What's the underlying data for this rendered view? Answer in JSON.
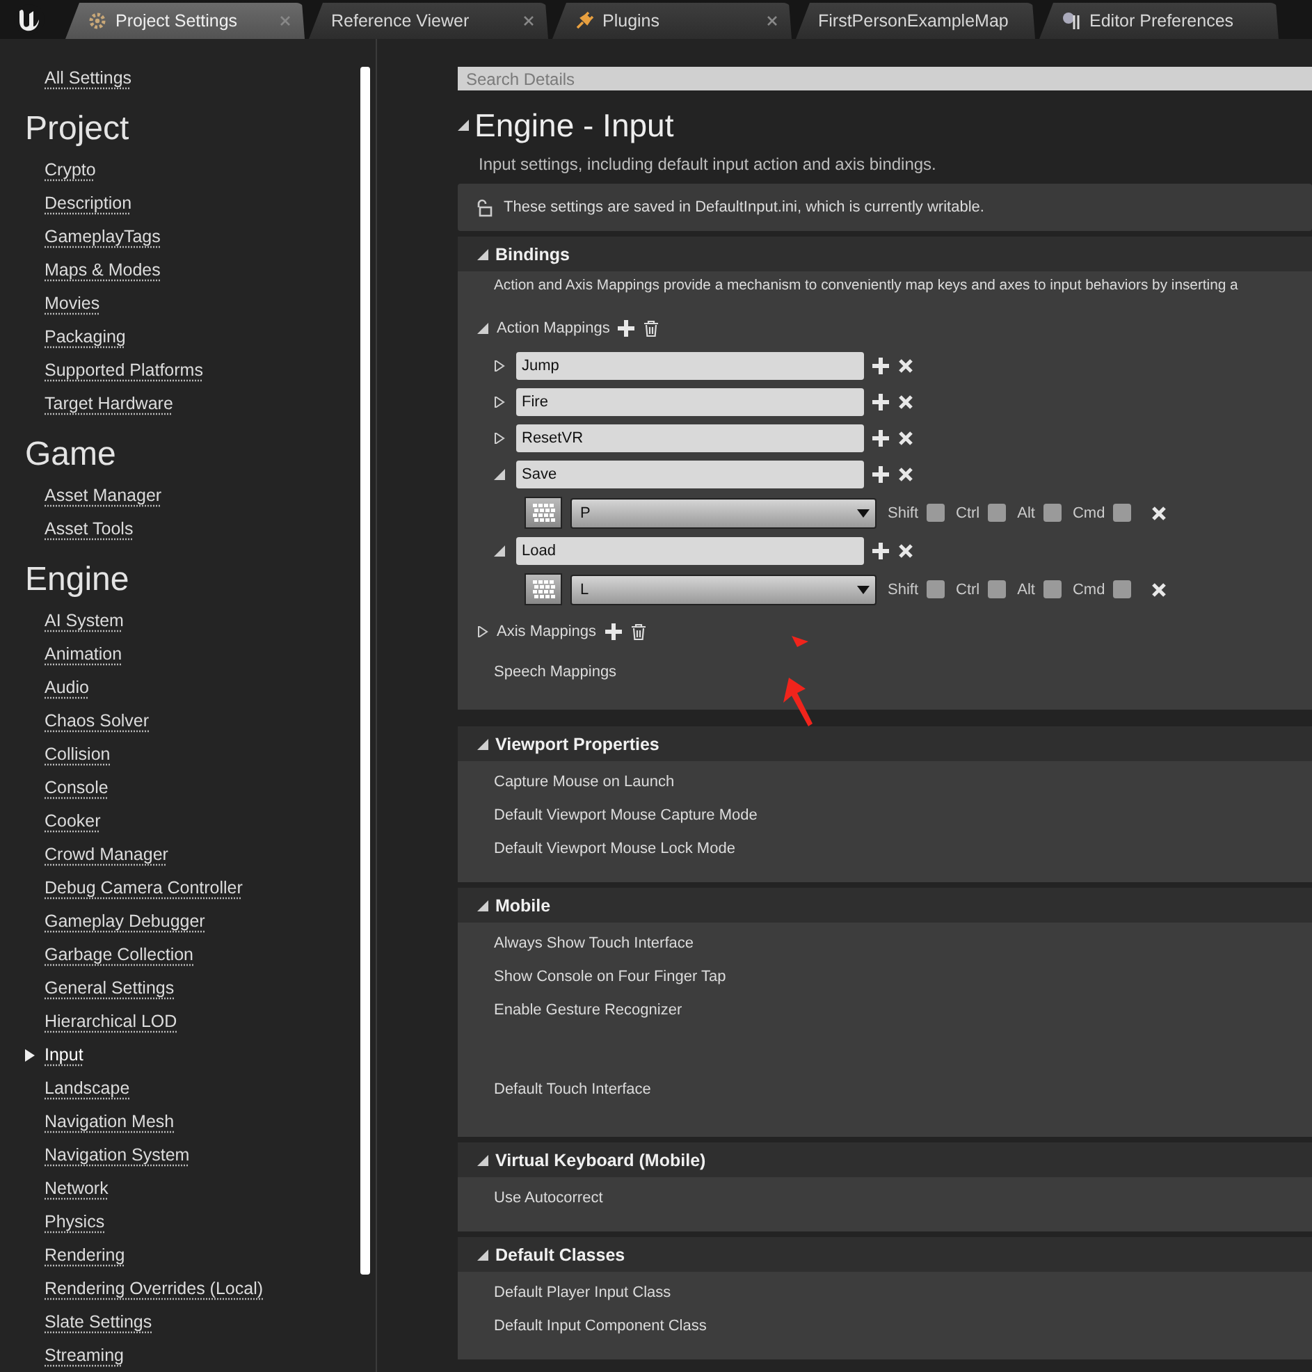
{
  "tabs": [
    {
      "label": "Project Settings",
      "selected": true,
      "closable": true
    },
    {
      "label": "Reference Viewer",
      "selected": false,
      "closable": true
    },
    {
      "label": "Plugins",
      "selected": false,
      "closable": true
    },
    {
      "label": "FirstPersonExampleMap",
      "selected": false,
      "closable": false
    },
    {
      "label": "Editor Preferences",
      "selected": false,
      "closable": false
    }
  ],
  "sidebar": {
    "all_settings": "All Settings",
    "groups": [
      {
        "title": "Project",
        "items": [
          {
            "label": "Crypto",
            "selected": false
          },
          {
            "label": "Description",
            "selected": false
          },
          {
            "label": "GameplayTags",
            "selected": false
          },
          {
            "label": "Maps & Modes",
            "selected": false
          },
          {
            "label": "Movies",
            "selected": false
          },
          {
            "label": "Packaging",
            "selected": false
          },
          {
            "label": "Supported Platforms",
            "selected": false
          },
          {
            "label": "Target Hardware",
            "selected": false
          }
        ]
      },
      {
        "title": "Game",
        "items": [
          {
            "label": "Asset Manager",
            "selected": false
          },
          {
            "label": "Asset Tools",
            "selected": false
          }
        ]
      },
      {
        "title": "Engine",
        "items": [
          {
            "label": "AI System",
            "selected": false
          },
          {
            "label": "Animation",
            "selected": false
          },
          {
            "label": "Audio",
            "selected": false
          },
          {
            "label": "Chaos Solver",
            "selected": false
          },
          {
            "label": "Collision",
            "selected": false
          },
          {
            "label": "Console",
            "selected": false
          },
          {
            "label": "Cooker",
            "selected": false
          },
          {
            "label": "Crowd Manager",
            "selected": false
          },
          {
            "label": "Debug Camera Controller",
            "selected": false
          },
          {
            "label": "Gameplay Debugger",
            "selected": false
          },
          {
            "label": "Garbage Collection",
            "selected": false
          },
          {
            "label": "General Settings",
            "selected": false
          },
          {
            "label": "Hierarchical LOD",
            "selected": false
          },
          {
            "label": "Input",
            "selected": true
          },
          {
            "label": "Landscape",
            "selected": false
          },
          {
            "label": "Navigation Mesh",
            "selected": false
          },
          {
            "label": "Navigation System",
            "selected": false
          },
          {
            "label": "Network",
            "selected": false
          },
          {
            "label": "Physics",
            "selected": false
          },
          {
            "label": "Rendering",
            "selected": false
          },
          {
            "label": "Rendering Overrides (Local)",
            "selected": false
          },
          {
            "label": "Slate Settings",
            "selected": false
          },
          {
            "label": "Streaming",
            "selected": false
          }
        ]
      }
    ]
  },
  "search": {
    "placeholder": "Search Details"
  },
  "title": "Engine - Input",
  "description": "Input settings, including default input action and axis bindings.",
  "notice": "These settings are saved in DefaultInput.ini, which is currently writable.",
  "bindings": {
    "title": "Bindings",
    "expanded": true,
    "description": "Action and Axis Mappings provide a mechanism to conveniently map keys and axes to input behaviors by inserting a",
    "action_mappings": {
      "label": "Action Mappings",
      "expanded": true,
      "items": [
        {
          "name": "Jump",
          "expanded": false
        },
        {
          "name": "Fire",
          "expanded": false
        },
        {
          "name": "ResetVR",
          "expanded": false
        },
        {
          "name": "Save",
          "expanded": true,
          "key": "P",
          "modifiers": [
            {
              "label": "Shift",
              "checked": false
            },
            {
              "label": "Ctrl",
              "checked": false
            },
            {
              "label": "Alt",
              "checked": false
            },
            {
              "label": "Cmd",
              "checked": false
            }
          ]
        },
        {
          "name": "Load",
          "expanded": true,
          "key": "L",
          "modifiers": [
            {
              "label": "Shift",
              "checked": false
            },
            {
              "label": "Ctrl",
              "checked": false
            },
            {
              "label": "Alt",
              "checked": false
            },
            {
              "label": "Cmd",
              "checked": false
            }
          ]
        }
      ]
    },
    "axis_mappings": {
      "label": "Axis Mappings",
      "expanded": false
    },
    "speech_mappings": "Speech Mappings"
  },
  "sections": [
    {
      "title": "Viewport Properties",
      "expanded": true,
      "rows": [
        {
          "label": "Capture Mouse on Launch",
          "kind": "plain"
        },
        {
          "label": "Default Viewport Mouse Capture Mode",
          "kind": "plain"
        },
        {
          "label": "Default Viewport Mouse Lock Mode",
          "kind": "plain"
        }
      ]
    },
    {
      "title": "Mobile",
      "expanded": true,
      "rows": [
        {
          "label": "Always Show Touch Interface",
          "kind": "plain"
        },
        {
          "label": "Show Console on Four Finger Tap",
          "kind": "plain"
        },
        {
          "label": "Enable Gesture Recognizer",
          "kind": "plain"
        },
        {
          "label": "Default Touch Interface",
          "kind": "tall"
        }
      ]
    },
    {
      "title": "Virtual Keyboard (Mobile)",
      "expanded": true,
      "rows": [
        {
          "label": "Use Autocorrect",
          "kind": "plain"
        }
      ]
    },
    {
      "title": "Default Classes",
      "expanded": true,
      "rows": [
        {
          "label": "Default Player Input Class",
          "kind": "plain"
        },
        {
          "label": "Default Input Component Class",
          "kind": "plain"
        }
      ]
    }
  ]
}
